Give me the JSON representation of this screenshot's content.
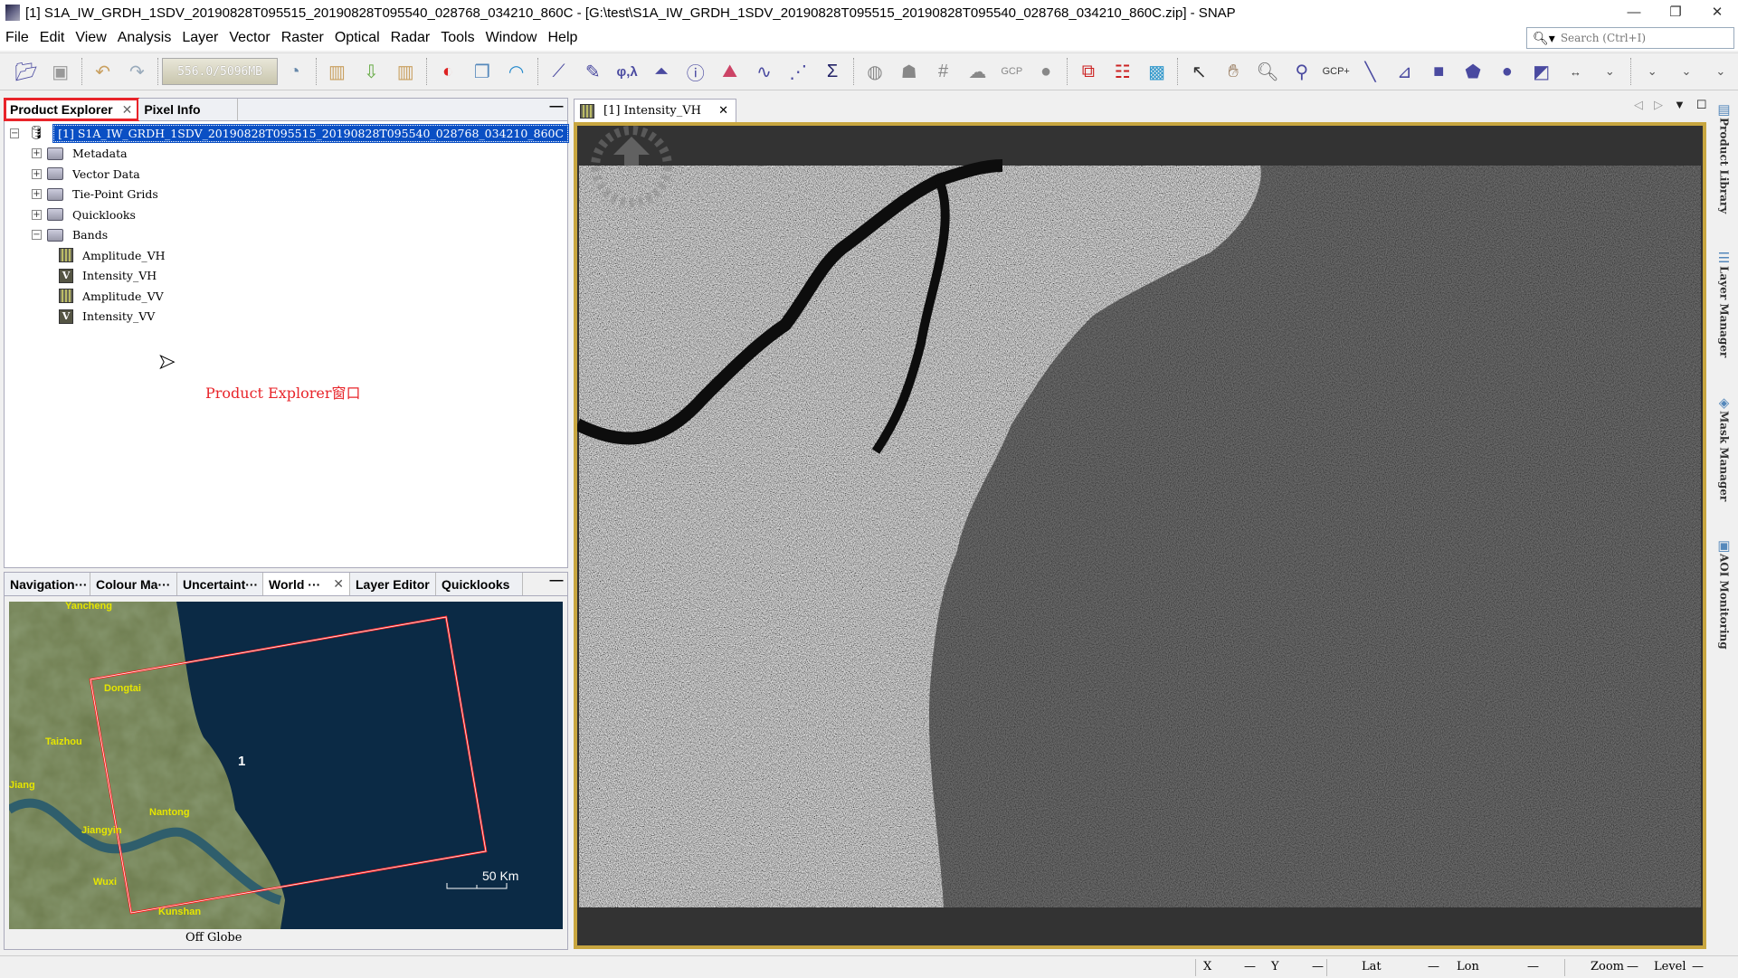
{
  "window": {
    "title": "[1] S1A_IW_GRDH_1SDV_20190828T095515_20190828T095540_028768_034210_860C - [G:\\test\\S1A_IW_GRDH_1SDV_20190828T095515_20190828T095540_028768_034210_860C.zip] - SNAP",
    "minimize": "—",
    "restore": "❐",
    "close": "✕"
  },
  "menu": [
    "File",
    "Edit",
    "View",
    "Analysis",
    "Layer",
    "Vector",
    "Raster",
    "Optical",
    "Radar",
    "Tools",
    "Window",
    "Help"
  ],
  "search": {
    "placeholder": "Search (Ctrl+I)"
  },
  "toolbar": {
    "memory": "556.0/5096MB",
    "icons": [
      "open-product-icon",
      "save-product-icon",
      "undo-icon",
      "redo-icon",
      "memory-gauge",
      "session-icon",
      "import-icon",
      "import-green-icon",
      "export-icon",
      "rgb-image-icon",
      "window-icon",
      "wave-icon",
      "profile-plot-icon",
      "band-maths-icon",
      "geo-coding-icon",
      "histogram-icon",
      "information-icon",
      "spectrum-icon",
      "time-series-icon",
      "scatter-plot-icon",
      "sigma-icon",
      "globe-icon",
      "graph-builder-icon",
      "grid-icon",
      "sar-icon",
      "gcp-icon",
      "terrain-icon",
      "graph-icon",
      "batch-processing-icon",
      "world-map-icon",
      "select-tool-icon",
      "pan-tool-icon",
      "zoom-tool-icon",
      "pin-tool-icon",
      "gcp-tool-icon",
      "line-tool-icon",
      "polyline-tool-icon",
      "rectangle-tool-icon",
      "polygon-tool-icon",
      "ellipse-tool-icon",
      "shape-tool-icon",
      "range-finder-icon"
    ],
    "gcp_label": "GCP"
  },
  "product_explorer": {
    "tabs": [
      {
        "label": "Product Explorer"
      },
      {
        "label": "Pixel Info"
      }
    ],
    "product": "[1] S1A_IW_GRDH_1SDV_20190828T095515_20190828T095540_028768_034210_860C",
    "folders": [
      "Metadata",
      "Vector Data",
      "Tie-Point Grids",
      "Quicklooks",
      "Bands"
    ],
    "bands": [
      {
        "name": "Amplitude_VH",
        "type": "amp"
      },
      {
        "name": "Intensity_VH",
        "type": "int",
        "badge": "V"
      },
      {
        "name": "Amplitude_VV",
        "type": "amp"
      },
      {
        "name": "Intensity_VV",
        "type": "int",
        "badge": "V"
      }
    ],
    "annotation": "Product Explorer窗口",
    "annotation_color": "#e8242a"
  },
  "bottom_panel": {
    "tabs": [
      "Navigation···",
      "Colour Ma···",
      "Uncertaint···",
      "World ···",
      "Layer Editor",
      "Quicklooks"
    ],
    "active_tab": "World ···",
    "map_labels": [
      "Yancheng",
      "Dongtai",
      "Taizhou",
      "Jiang",
      "Nantong",
      "Jiangyin",
      "Wuxi",
      "Kunshan"
    ],
    "footprint_label": "1",
    "scale": "50 Km",
    "footer": "Off Globe"
  },
  "image_view": {
    "tab": "[1] Intensity_VH"
  },
  "right_sidebar": [
    "Product Library",
    "Layer Manager",
    "Mask Manager",
    "AOI Monitoring"
  ],
  "status": {
    "x_label": "X",
    "x": "—",
    "y_label": "Y",
    "y": "—",
    "lat_label": "Lat",
    "lat": "—",
    "lon_label": "Lon",
    "lon": "—",
    "zoom_label": "Zoom",
    "zoom": "—",
    "level_label": "Level",
    "level": "—"
  },
  "colors": {
    "selection": "#0a4fc4",
    "highlight_box": "#e8242a",
    "view_border": "#c8a640",
    "footprint": "#ff2020"
  }
}
